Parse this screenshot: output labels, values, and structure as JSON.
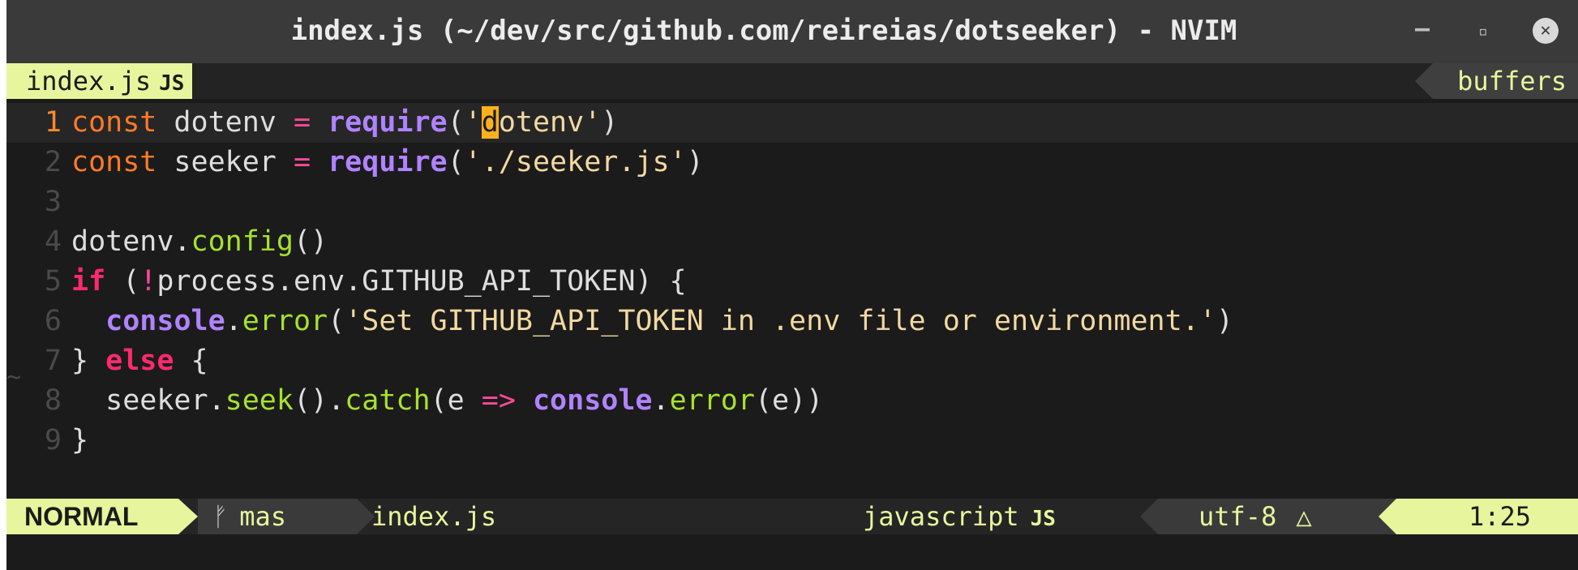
{
  "window": {
    "title": "index.js (~/dev/src/github.com/reireias/dotseeker) - NVIM",
    "minimize_glyph": "–",
    "maximize_glyph": "▫",
    "close_glyph": "✕"
  },
  "tabline": {
    "active_buffer": "index.js",
    "active_filetype_icon": "JS",
    "buffers_label": "buffers"
  },
  "editor": {
    "cursor": {
      "line": 1,
      "column": 25
    },
    "empty_line_marker": "~",
    "lines": [
      {
        "number": "1",
        "tokens": [
          [
            "kw",
            "const"
          ],
          [
            "txt",
            " dotenv "
          ],
          [
            "op",
            "="
          ],
          [
            "txt",
            " "
          ],
          [
            "fn",
            "require"
          ],
          [
            "txt",
            "("
          ],
          [
            "str",
            "'"
          ],
          [
            "cursor",
            "d"
          ],
          [
            "str",
            "otenv'"
          ],
          [
            "txt",
            ")"
          ]
        ]
      },
      {
        "number": "2",
        "tokens": [
          [
            "kw",
            "const"
          ],
          [
            "txt",
            " seeker "
          ],
          [
            "op",
            "="
          ],
          [
            "txt",
            " "
          ],
          [
            "fn",
            "require"
          ],
          [
            "txt",
            "("
          ],
          [
            "str",
            "'./seeker.js'"
          ],
          [
            "txt",
            ")"
          ]
        ]
      },
      {
        "number": "3",
        "tokens": []
      },
      {
        "number": "4",
        "tokens": [
          [
            "txt",
            "dotenv."
          ],
          [
            "meth",
            "config"
          ],
          [
            "txt",
            "()"
          ]
        ]
      },
      {
        "number": "5",
        "tokens": [
          [
            "ctrl",
            "if"
          ],
          [
            "txt",
            " ("
          ],
          [
            "op",
            "!"
          ],
          [
            "txt",
            "process.env.GITHUB_API_TOKEN) {"
          ]
        ]
      },
      {
        "number": "6",
        "tokens": [
          [
            "txt",
            "  "
          ],
          [
            "fn",
            "console"
          ],
          [
            "txt",
            "."
          ],
          [
            "meth",
            "error"
          ],
          [
            "txt",
            "("
          ],
          [
            "str",
            "'Set GITHUB_API_TOKEN in .env file or environment.'"
          ],
          [
            "txt",
            ")"
          ]
        ]
      },
      {
        "number": "7",
        "tokens": [
          [
            "txt",
            "} "
          ],
          [
            "ctrl",
            "else"
          ],
          [
            "txt",
            " {"
          ]
        ]
      },
      {
        "number": "8",
        "tokens": [
          [
            "txt",
            "  seeker."
          ],
          [
            "meth",
            "seek"
          ],
          [
            "txt",
            "()."
          ],
          [
            "meth",
            "catch"
          ],
          [
            "txt",
            "(e "
          ],
          [
            "op",
            "=>"
          ],
          [
            "txt",
            " "
          ],
          [
            "fn",
            "console"
          ],
          [
            "txt",
            "."
          ],
          [
            "meth",
            "error"
          ],
          [
            "txt",
            "(e))"
          ]
        ]
      },
      {
        "number": "9",
        "tokens": [
          [
            "txt",
            "}"
          ]
        ]
      }
    ]
  },
  "statusline": {
    "mode": "NORMAL",
    "branch_icon": "ᚠ",
    "branch": "mas",
    "filename": "index.js",
    "filetype": "javascript",
    "filetype_icon": "JS",
    "encoding": "utf-8",
    "os_icon": "△",
    "position": "1:25"
  },
  "colors": {
    "mode_bg": "#e7f59c",
    "keyword": "#ff7a28",
    "operator": "#ff4a9b",
    "builtin": "#b083ff",
    "string": "#f2d9a2",
    "method": "#a6e22e",
    "control": "#ff2a6d",
    "cursor": "#ffb020",
    "current_line_number": "#ff8a2a"
  }
}
